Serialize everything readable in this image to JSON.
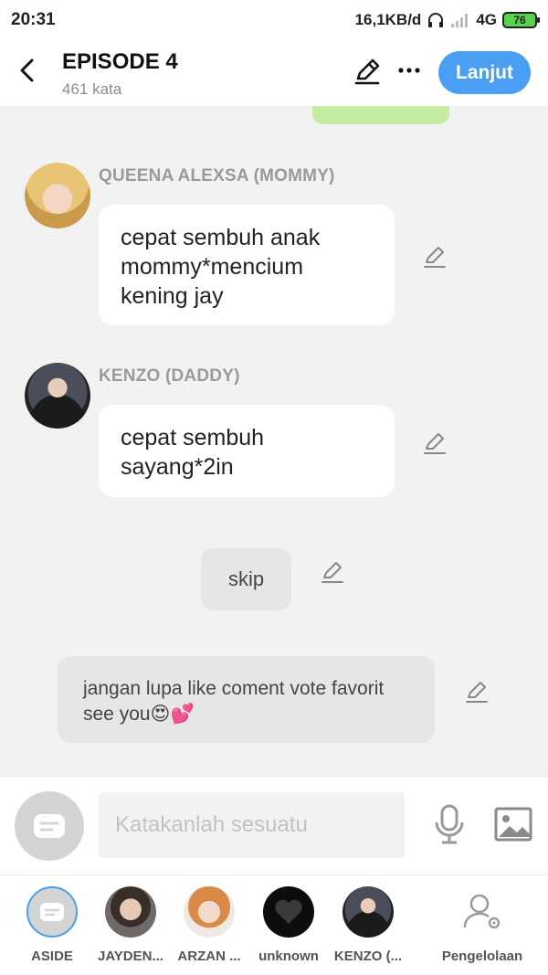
{
  "status_bar": {
    "time": "20:31",
    "speed": "16,1KB/d",
    "network": "4G",
    "battery": "76"
  },
  "header": {
    "title": "EPISODE 4",
    "word_count": "461 kata",
    "next_label": "Lanjut"
  },
  "messages": [
    {
      "speaker": "QUEENA ALEXSA (MOMMY)",
      "text": "cepat sembuh anak mommy*mencium kening jay"
    },
    {
      "speaker": "KENZO (DADDY)",
      "text": "cepat sembuh sayang*2in"
    }
  ],
  "skip_text": "skip",
  "aside_text": "jangan lupa like coment vote favorit see you😍💕",
  "input": {
    "placeholder": "Katakanlah sesuatu"
  },
  "characters": [
    {
      "label": "ASIDE"
    },
    {
      "label": "JAYDEN..."
    },
    {
      "label": "ARZAN ..."
    },
    {
      "label": "unknown"
    },
    {
      "label": "KENZO (..."
    }
  ],
  "manage_label": "Pengelolaan",
  "colors": {
    "accent": "#4a9ff2",
    "battery": "#58d24e",
    "green_bubble": "#c6eca1"
  }
}
